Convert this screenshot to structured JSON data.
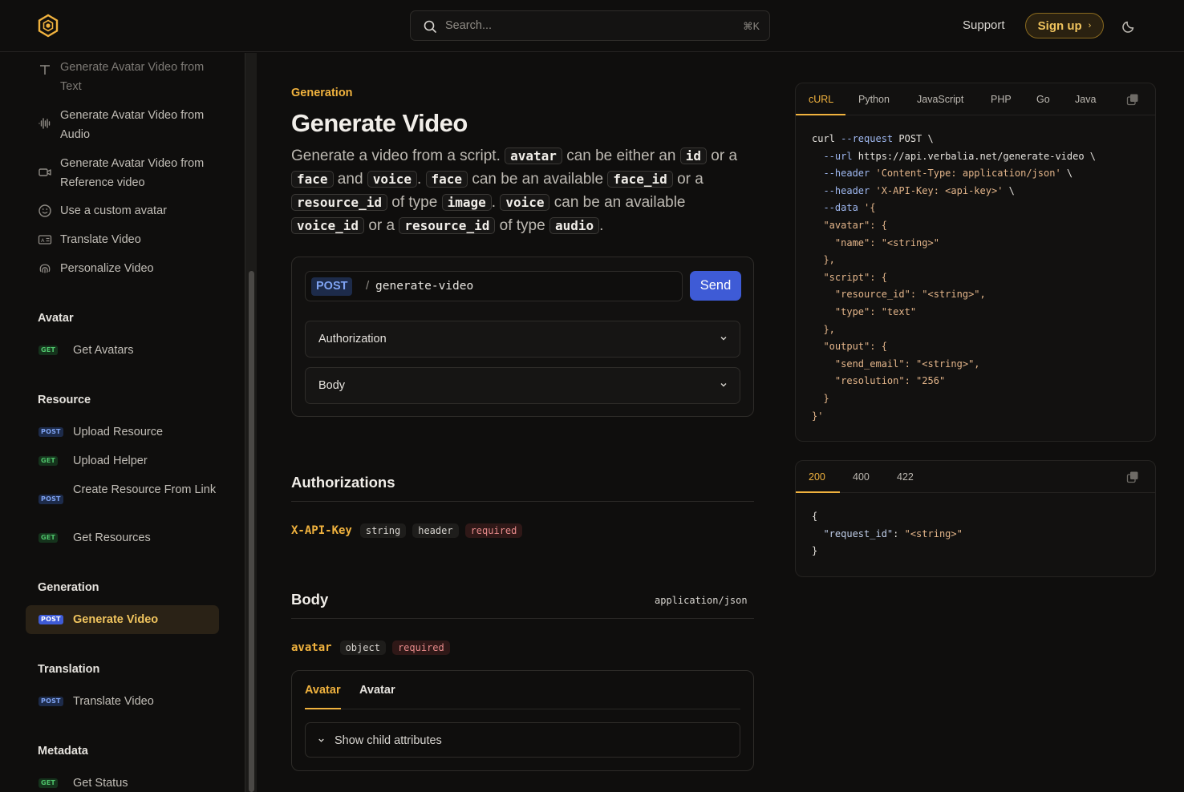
{
  "header": {
    "search_placeholder": "Search...",
    "search_shortcut": "⌘K",
    "support": "Support",
    "signup": "Sign up"
  },
  "sidebar": {
    "top_items": [
      {
        "label": "Generate Avatar Video from Text",
        "icon": "text-icon"
      },
      {
        "label": "Generate Avatar Video from Audio",
        "icon": "waveform-icon"
      },
      {
        "label": "Generate Avatar Video from Reference video",
        "icon": "video-icon"
      },
      {
        "label": "Use a custom avatar",
        "icon": "smile-icon"
      },
      {
        "label": "Translate Video",
        "icon": "translate-icon"
      },
      {
        "label": "Personalize Video",
        "icon": "fingerprint-icon"
      }
    ],
    "sections": {
      "avatar": {
        "title": "Avatar",
        "items": [
          {
            "method": "GET",
            "label": "Get Avatars"
          }
        ]
      },
      "resource": {
        "title": "Resource",
        "items": [
          {
            "method": "POST",
            "label": "Upload Resource"
          },
          {
            "method": "GET",
            "label": "Upload Helper"
          },
          {
            "method": "POST",
            "label": "Create Resource From Link"
          },
          {
            "method": "GET",
            "label": "Get Resources"
          }
        ]
      },
      "generation": {
        "title": "Generation",
        "items": [
          {
            "method": "POST",
            "label": "Generate Video"
          }
        ]
      },
      "translation": {
        "title": "Translation",
        "items": [
          {
            "method": "POST",
            "label": "Translate Video"
          }
        ]
      },
      "metadata": {
        "title": "Metadata",
        "items": [
          {
            "method": "GET",
            "label": "Get Status"
          }
        ]
      }
    }
  },
  "main": {
    "eyebrow": "Generation",
    "title": "Generate Video",
    "desc": {
      "t1": "Generate a video from a script. ",
      "c1": "avatar",
      "t2": " can be either an ",
      "c2": "id",
      "t3": " or a ",
      "c3": "face",
      "t4": " and ",
      "c4": "voice",
      "t5": ". ",
      "c5": "face",
      "t6": " can be an available ",
      "c6": "face_id",
      "t7": " or a ",
      "c7": "resource_id",
      "t8": " of type ",
      "c8": "image",
      "t9": ". ",
      "c9": "voice",
      "t10": " can be an available ",
      "c10": "voice_id",
      "t11": " or a ",
      "c11": "resource_id",
      "t12": " of type ",
      "c12": "audio",
      "t13": "."
    },
    "playground": {
      "method": "POST",
      "separator": "/",
      "path": "generate-video",
      "send": "Send",
      "authorization": "Authorization",
      "body": "Body"
    },
    "authorizations": {
      "title": "Authorizations",
      "param": {
        "name": "X-API-Key",
        "type": "string",
        "location": "header",
        "required": "required"
      }
    },
    "body": {
      "title": "Body",
      "content_type": "application/json",
      "param": {
        "name": "avatar",
        "type": "object",
        "required": "required"
      },
      "tabs": [
        "Avatar",
        "Avatar"
      ],
      "show_child": "Show child attributes"
    }
  },
  "request_panel": {
    "tabs": [
      "cURL",
      "Python",
      "JavaScript",
      "PHP",
      "Go",
      "Java"
    ],
    "active_tab": "cURL",
    "code": {
      "l1a": "curl ",
      "l1b": "--request",
      "l1c": " POST \\",
      "l2a": "  --url",
      "l2b": " https://api.verbalia.net/generate-video \\",
      "l3a": "  --header",
      "l3b": " 'Content-Type: application/json'",
      "l3c": " \\",
      "l4a": "  --header",
      "l4b": " 'X-API-Key: <api-key>'",
      "l4c": " \\",
      "l5a": "  --data",
      "l5b": " '{",
      "l6": "  \"avatar\": {",
      "l7": "    \"name\": \"<string>\"",
      "l8": "  },",
      "l9": "  \"script\": {",
      "l10": "    \"resource_id\": \"<string>\",",
      "l11": "    \"type\": \"text\"",
      "l12": "  },",
      "l13": "  \"output\": {",
      "l14": "    \"send_email\": \"<string>\",",
      "l15": "    \"resolution\": \"256\"",
      "l16": "  }",
      "l17": "}'"
    }
  },
  "response_panel": {
    "tabs": [
      "200",
      "400",
      "422"
    ],
    "active_tab": "200",
    "code": {
      "l1": "{",
      "l2a": "  \"request_id\"",
      "l2b": ": ",
      "l2c": "\"<string>\"",
      "l3": "}"
    }
  },
  "colors": {
    "accent": "#f0b23e",
    "primary_button": "#3e5bd6",
    "background": "#0f0e0d"
  }
}
